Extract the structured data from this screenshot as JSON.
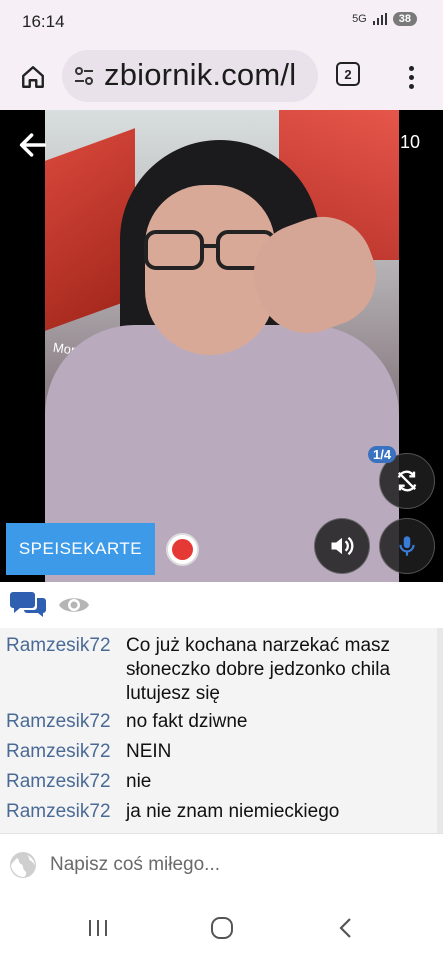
{
  "status_bar": {
    "time": "16:14",
    "network": "5G",
    "battery": "38"
  },
  "browser": {
    "url": "zbiornik.com/l",
    "tab_count": "2"
  },
  "stream": {
    "viewer_count": "10",
    "camera_counter": "1/4",
    "menu_button_label": "SPEISEKARTE",
    "sign_text": "Monta"
  },
  "chat": {
    "messages": [
      {
        "user": "Ramzesik72",
        "text": "Co już kochana narzekać masz słoneczko dobre jedzonko chila lutujesz się"
      },
      {
        "user": "Ramzesik72",
        "text": "no fakt dziwne"
      },
      {
        "user": "Ramzesik72",
        "text": "NEIN"
      },
      {
        "user": "Ramzesik72",
        "text": "nie"
      },
      {
        "user": "Ramzesik72",
        "text": "ja nie znam niemieckiego"
      }
    ],
    "input_placeholder": "Napisz coś miłego..."
  },
  "colors": {
    "accent": "#3d9ae8",
    "username": "#4a6a96",
    "record": "#e53935",
    "chat_icon": "#2f5fb0"
  },
  "icons": [
    "home-icon",
    "tune-icon",
    "tabs-icon",
    "more-vert-icon",
    "back-arrow-icon",
    "camera-flip-icon",
    "speaker-icon",
    "mic-icon",
    "chat-bubbles-icon",
    "eye-icon",
    "globe-icon",
    "recent-apps-icon",
    "home-circle-icon",
    "back-chevron-icon"
  ]
}
